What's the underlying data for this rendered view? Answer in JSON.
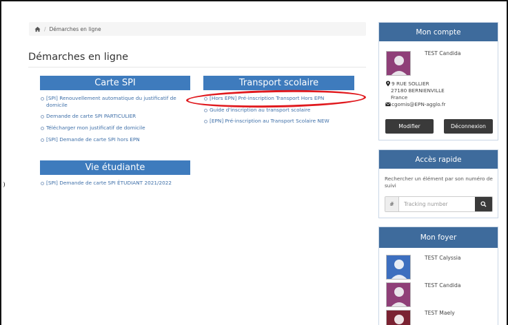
{
  "breadcrumb": {
    "home_icon": "home-icon",
    "current": "Démarches en ligne"
  },
  "page": {
    "title": "Démarches en ligne"
  },
  "categories": {
    "carte_spi": {
      "title": "Carte SPI",
      "links": [
        "[SPI] Renouvellement automatique du justificatif de domicile",
        "Demande de carte SPI PARTICULIER",
        "Télécharger mon justificatif de domicile",
        "[SPI] Demande de carte SPI hors EPN"
      ]
    },
    "transport": {
      "title": "Transport scolaire",
      "links": [
        "[Hors EPN] Pré-inscription Transport Hors EPN",
        "Guide d'inscription au transport scolaire",
        "[EPN] Pré-inscription au Transport Scolaire NEW"
      ]
    },
    "vie_etudiante": {
      "title": "Vie étudiante",
      "links": [
        "[SPI] Demande de carte SPI ÉTUDIANT 2021/2022"
      ]
    }
  },
  "account": {
    "title": "Mon compte",
    "name": "TEST Candida",
    "address_line1": "9 RUE SOLLIER",
    "address_line2": "27180 BERNIENVILLE",
    "country": "France",
    "email": "cgomis@EPN-agglo.fr",
    "modify_label": "Modifier",
    "logout_label": "Déconnexion"
  },
  "quick_access": {
    "title": "Accès rapide",
    "description": "Rechercher un élément par son numéro de suivi",
    "prefix": "#",
    "placeholder": "Tracking number"
  },
  "household": {
    "title": "Mon foyer",
    "members": [
      "TEST Calyssia",
      "TEST Candida",
      "TEST Maely"
    ]
  },
  "colors": {
    "category_header": "#3e7bbd",
    "panel_header": "#3e6b9c",
    "link": "#3e6fa8",
    "highlight": "#e0191e",
    "dark_button": "#3a3a3a"
  }
}
